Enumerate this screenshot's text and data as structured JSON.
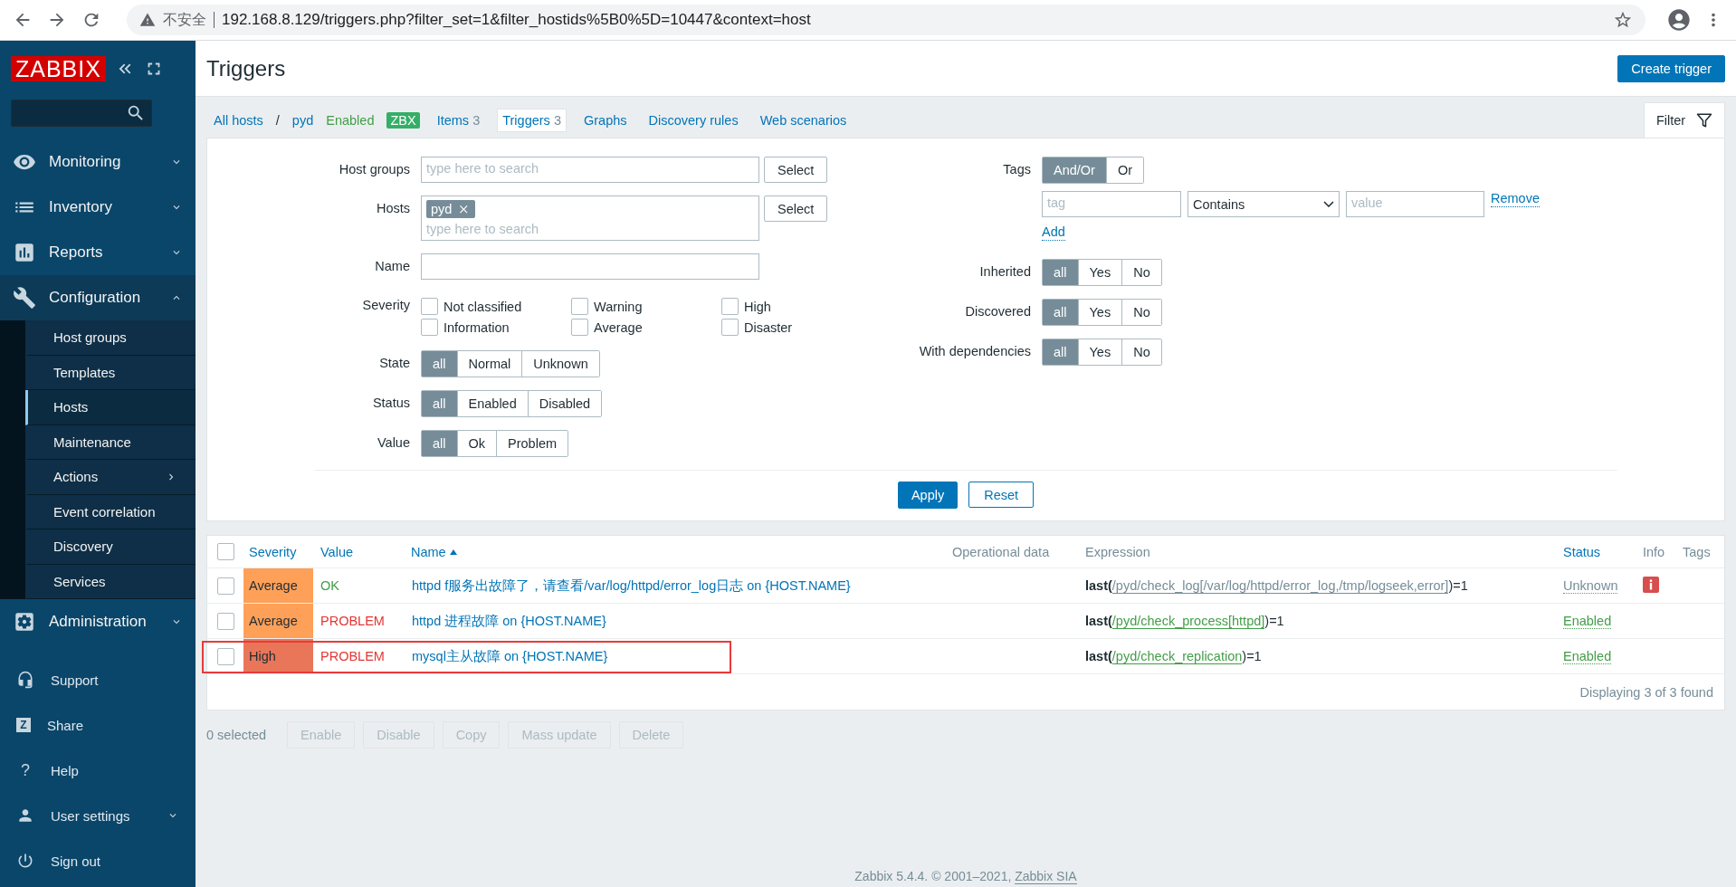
{
  "browser": {
    "security_label": "不安全",
    "url": "192.168.8.129/triggers.php?filter_set=1&filter_hostids%5B0%5D=10447&context=host"
  },
  "sidebar": {
    "logo": "ZABBIX",
    "menu": [
      {
        "label": "Monitoring",
        "expanded": false
      },
      {
        "label": "Inventory",
        "expanded": false
      },
      {
        "label": "Reports",
        "expanded": false
      },
      {
        "label": "Configuration",
        "expanded": true,
        "children": [
          {
            "label": "Host groups",
            "selected": false,
            "has_submenu": false
          },
          {
            "label": "Templates",
            "selected": false,
            "has_submenu": false
          },
          {
            "label": "Hosts",
            "selected": true,
            "has_submenu": false
          },
          {
            "label": "Maintenance",
            "selected": false,
            "has_submenu": false
          },
          {
            "label": "Actions",
            "selected": false,
            "has_submenu": true
          },
          {
            "label": "Event correlation",
            "selected": false,
            "has_submenu": false
          },
          {
            "label": "Discovery",
            "selected": false,
            "has_submenu": false
          },
          {
            "label": "Services",
            "selected": false,
            "has_submenu": false
          }
        ]
      },
      {
        "label": "Administration",
        "expanded": false
      }
    ],
    "footer_items": [
      {
        "label": "Support",
        "kind": "icon",
        "has_submenu": false
      },
      {
        "label": "Share",
        "kind": "letter",
        "icon_text": "Z",
        "has_submenu": false
      },
      {
        "label": "Help",
        "kind": "glyph",
        "icon_text": "?",
        "has_submenu": false
      },
      {
        "label": "User settings",
        "kind": "icon",
        "has_submenu": true
      },
      {
        "label": "Sign out",
        "kind": "icon",
        "has_submenu": false
      }
    ]
  },
  "header": {
    "title": "Triggers",
    "create_button": "Create trigger"
  },
  "host_nav": {
    "all_hosts": "All hosts",
    "separator": "/",
    "host": "pyd",
    "status": "Enabled",
    "availability": "ZBX",
    "tabs": [
      {
        "label": "Items",
        "count": "3",
        "selected": false
      },
      {
        "label": "Triggers",
        "count": "3",
        "selected": true
      },
      {
        "label": "Graphs",
        "selected": false
      },
      {
        "label": "Discovery rules",
        "selected": false
      },
      {
        "label": "Web scenarios",
        "selected": false
      }
    ],
    "filter_tab": "Filter"
  },
  "filter": {
    "host_groups": {
      "label": "Host groups",
      "placeholder": "type here to search",
      "button": "Select"
    },
    "hosts": {
      "label": "Hosts",
      "chips": [
        "pyd"
      ],
      "placeholder": "type here to search",
      "button": "Select"
    },
    "name": {
      "label": "Name"
    },
    "severity": {
      "label": "Severity",
      "options": [
        {
          "label": "Not classified",
          "checked": false
        },
        {
          "label": "Information",
          "checked": false
        },
        {
          "label": "Warning",
          "checked": false
        },
        {
          "label": "Average",
          "checked": false
        },
        {
          "label": "High",
          "checked": false
        },
        {
          "label": "Disaster",
          "checked": false
        }
      ]
    },
    "state": {
      "label": "State",
      "options": [
        {
          "label": "all",
          "selected": true
        },
        {
          "label": "Normal",
          "selected": false
        },
        {
          "label": "Unknown",
          "selected": false
        }
      ]
    },
    "status": {
      "label": "Status",
      "options": [
        {
          "label": "all",
          "selected": true
        },
        {
          "label": "Enabled",
          "selected": false
        },
        {
          "label": "Disabled",
          "selected": false
        }
      ]
    },
    "value": {
      "label": "Value",
      "options": [
        {
          "label": "all",
          "selected": true
        },
        {
          "label": "Ok",
          "selected": false
        },
        {
          "label": "Problem",
          "selected": false
        }
      ]
    },
    "tags": {
      "label": "Tags",
      "operators": [
        {
          "label": "And/Or",
          "selected": true
        },
        {
          "label": "Or",
          "selected": false
        }
      ],
      "rows": [
        {
          "tag_placeholder": "tag",
          "operator": "Contains",
          "value_placeholder": "value",
          "remove": "Remove"
        }
      ],
      "add": "Add"
    },
    "inherited": {
      "label": "Inherited",
      "options": [
        {
          "label": "all",
          "selected": true
        },
        {
          "label": "Yes",
          "selected": false
        },
        {
          "label": "No",
          "selected": false
        }
      ]
    },
    "discovered": {
      "label": "Discovered",
      "options": [
        {
          "label": "all",
          "selected": true
        },
        {
          "label": "Yes",
          "selected": false
        },
        {
          "label": "No",
          "selected": false
        }
      ]
    },
    "with_dependencies": {
      "label": "With dependencies",
      "options": [
        {
          "label": "all",
          "selected": true
        },
        {
          "label": "Yes",
          "selected": false
        },
        {
          "label": "No",
          "selected": false
        }
      ]
    },
    "apply": "Apply",
    "reset": "Reset"
  },
  "table": {
    "select_all": {
      "checked": false
    },
    "columns": [
      {
        "label": "Severity",
        "sortable": true,
        "sorted": false
      },
      {
        "label": "Value",
        "sortable": true,
        "sorted": false
      },
      {
        "label": "Name",
        "sortable": true,
        "sorted": true
      },
      {
        "label": "Operational data",
        "sortable": false,
        "sorted": false
      },
      {
        "label": "Expression",
        "sortable": false,
        "sorted": false
      },
      {
        "label": "Status",
        "sortable": true,
        "sorted": false
      },
      {
        "label": "Info",
        "sortable": false,
        "sorted": false
      },
      {
        "label": "Tags",
        "sortable": false,
        "sorted": false
      }
    ],
    "rows": [
      {
        "checked": false,
        "severity": "Average",
        "color": "#ffa059",
        "value": "OK",
        "problem": false,
        "name": "httpd f服务出故障了，请查看/var/log/httpd/error_log日志 on {HOST.NAME}",
        "expression": {
          "function": "last(",
          "item": "/pyd/check_log[/var/log/httpd/error_log,/tmp/logseek,error]",
          "rest": ")=1"
        },
        "status": "Unknown",
        "status_unknown": true,
        "error_info": true,
        "highlighted": false
      },
      {
        "checked": false,
        "severity": "Average",
        "color": "#ffa059",
        "value": "PROBLEM",
        "problem": true,
        "name": "httpd 进程故障 on {HOST.NAME}",
        "expression": {
          "function": "last(",
          "item": "/pyd/check_process[httpd]",
          "rest": ")=1"
        },
        "status": "Enabled",
        "status_unknown": false,
        "error_info": false,
        "highlighted": false
      },
      {
        "checked": false,
        "severity": "High",
        "color": "#e97659",
        "value": "PROBLEM",
        "problem": true,
        "name": "mysql主从故障 on {HOST.NAME}",
        "expression": {
          "function": "last(",
          "item": "/pyd/check_replication",
          "rest": ")=1"
        },
        "status": "Enabled",
        "status_unknown": false,
        "error_info": false,
        "highlighted": true
      }
    ],
    "summary": "Displaying 3 of 3 found"
  },
  "actions": {
    "selected_count": "0 selected",
    "buttons": [
      {
        "label": "Enable",
        "disabled": true
      },
      {
        "label": "Disable",
        "disabled": true
      },
      {
        "label": "Copy",
        "disabled": true
      },
      {
        "label": "Mass update",
        "disabled": true
      },
      {
        "label": "Delete",
        "disabled": true
      }
    ]
  },
  "footer": {
    "text": "Zabbix 5.4.4. © 2001–2021, ",
    "link": "Zabbix SIA"
  }
}
